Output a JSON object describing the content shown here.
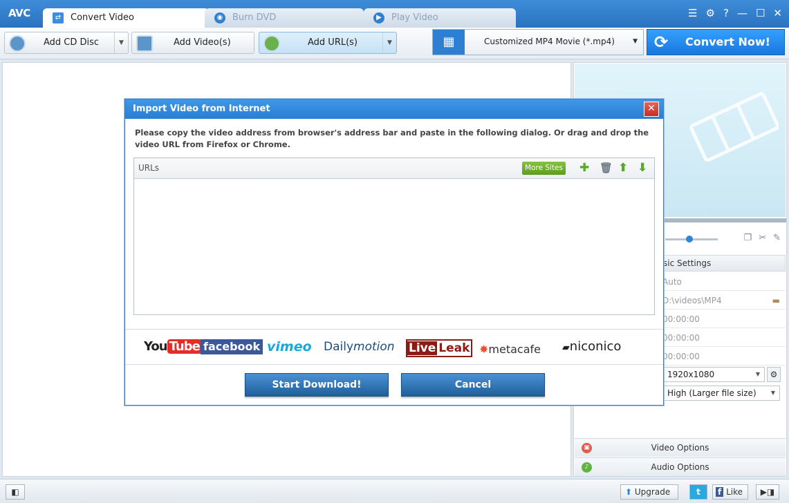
{
  "app": {
    "logo": "AVC",
    "tabs": [
      {
        "label": "Convert Video",
        "icon": "convert-video-icon"
      },
      {
        "label": "Burn DVD",
        "icon": "burn-dvd-icon"
      },
      {
        "label": "Play Video",
        "icon": "play-video-icon"
      }
    ],
    "window_controls": [
      "menu-icon",
      "gear-icon",
      "help-icon",
      "minimize-icon",
      "maximize-icon",
      "close-icon"
    ]
  },
  "toolbar": {
    "add_cd": "Add CD Disc",
    "add_video": "Add Video(s)",
    "add_url": "Add URL(s)",
    "format": "Customized MP4 Movie (*.mp4)",
    "convert": "Convert Now!"
  },
  "settings": {
    "header": "sic Settings",
    "rows": [
      "Auto",
      "D:\\videos\\MP4",
      "00:00:00",
      "00:00:00",
      "00:00:00"
    ],
    "resolution": "1920x1080",
    "quality": "High (Larger file size)",
    "video_options": "Video Options",
    "audio_options": "Audio Options"
  },
  "statusbar": {
    "upgrade": "Upgrade",
    "like": "Like"
  },
  "dialog": {
    "title": "Import Video from Internet",
    "instructions": "Please copy the video address from browser's address bar and paste in the following dialog. Or drag and drop the video URL from Firefox or Chrome.",
    "urls_label": "URLs",
    "more_sites": "More Sites",
    "sites": [
      {
        "part1": "You",
        "part2": "Tube",
        "id": "youtube"
      },
      {
        "part1": "facebook",
        "part2": "",
        "id": "facebook"
      },
      {
        "part1": "vimeo",
        "part2": "",
        "id": "vimeo"
      },
      {
        "part1": "Daily",
        "part2": "motion",
        "id": "dailymotion"
      },
      {
        "part1": "Live",
        "part2": "Leak",
        "id": "liveleak"
      },
      {
        "part1": "metacafe",
        "part2": "",
        "id": "metacafe"
      },
      {
        "part1": "niconico",
        "part2": "",
        "id": "niconico"
      }
    ],
    "start": "Start Download!",
    "cancel": "Cancel"
  },
  "colors": {
    "titlebar": "#2a72c0",
    "accent": "#1877dd",
    "green": "#5a9e1d",
    "close_red": "#c52d22"
  }
}
